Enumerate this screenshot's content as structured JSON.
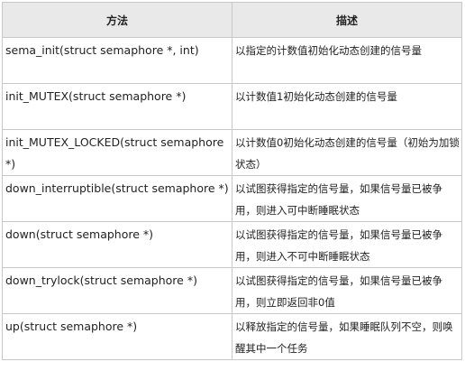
{
  "table": {
    "headers": {
      "method": "方法",
      "description": "描述"
    },
    "rows": [
      {
        "method": "sema_init(struct semaphore *, int)",
        "description": "以指定的计数值初始化动态创建的信号量"
      },
      {
        "method": "init_MUTEX(struct semaphore *)",
        "description": "以计数值1初始化动态创建的信号量"
      },
      {
        "method": "init_MUTEX_LOCKED(struct semaphore *)",
        "description": "以计数值0初始化动态创建的信号量（初始为加锁状态）"
      },
      {
        "method": "down_interruptible(struct semaphore *)",
        "description": "以试图获得指定的信号量，如果信号量已被争用，则进入可中断睡眠状态"
      },
      {
        "method": "down(struct semaphore *)",
        "description": "以试图获得指定的信号量，如果信号量已被争用，则进入不可中断睡眠状态"
      },
      {
        "method": "down_trylock(struct semaphore *)",
        "description": "以试图获得指定的信号量，如果信号量已被争用，则立即返回非0值"
      },
      {
        "method": "up(struct semaphore *)",
        "description": "以释放指定的信号量，如果睡眠队列不空，则唤醒其中一个任务"
      }
    ]
  }
}
